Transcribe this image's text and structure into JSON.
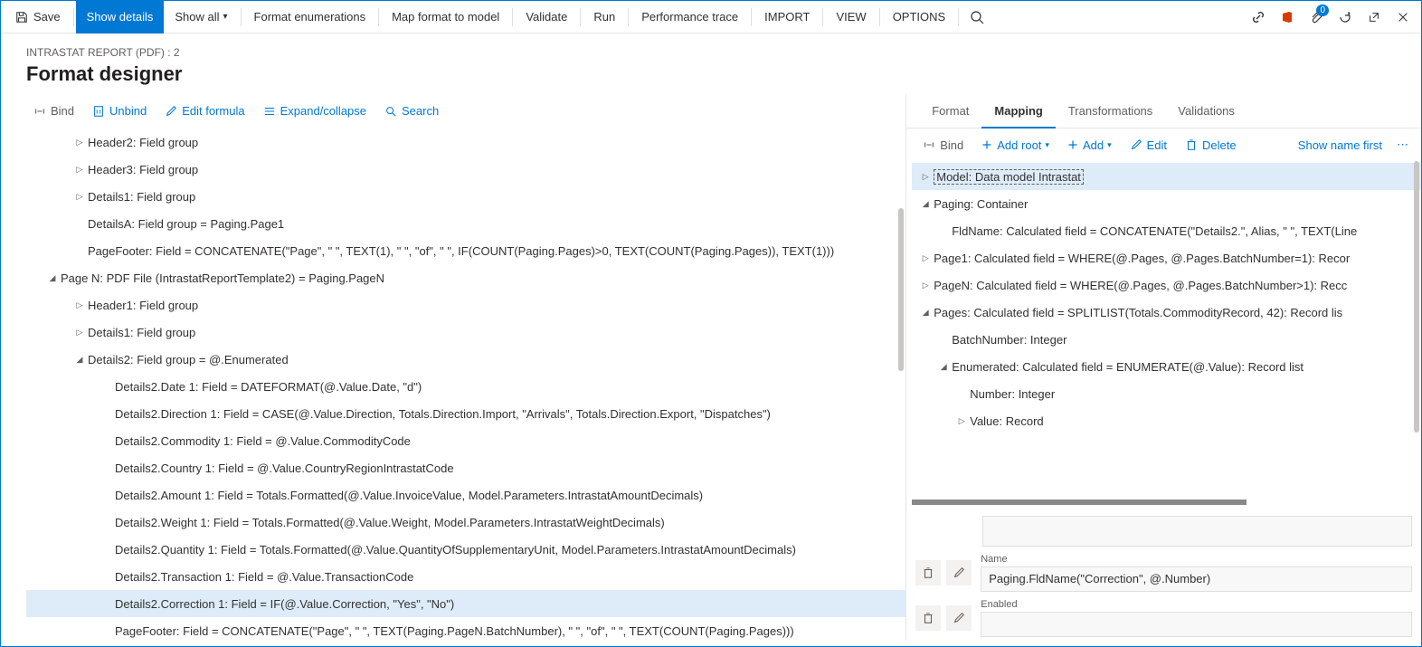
{
  "toolbar": {
    "save": "Save",
    "show_details": "Show details",
    "show_all": "Show all",
    "format_enum": "Format enumerations",
    "map_format": "Map format to model",
    "validate": "Validate",
    "run": "Run",
    "perf_trace": "Performance trace",
    "import": "IMPORT",
    "view": "VIEW",
    "options": "OPTIONS",
    "badge_count": "0"
  },
  "breadcrumb": "INTRASTAT REPORT (PDF) : 2",
  "page_title": "Format designer",
  "left_actions": {
    "bind": "Bind",
    "unbind": "Unbind",
    "edit_formula": "Edit formula",
    "expand": "Expand/collapse",
    "search": "Search"
  },
  "left_tree": [
    {
      "indent": 1,
      "toggle": "▷",
      "label": "Header2: Field group"
    },
    {
      "indent": 1,
      "toggle": "▷",
      "label": "Header3: Field group"
    },
    {
      "indent": 1,
      "toggle": "▷",
      "label": "Details1: Field group"
    },
    {
      "indent": 1,
      "toggle": "",
      "label": "DetailsA: Field group = Paging.Page1"
    },
    {
      "indent": 1,
      "toggle": "",
      "label": "PageFooter: Field = CONCATENATE(\"Page\", \" \", TEXT(1), \" \", \"of\", \" \", IF(COUNT(Paging.Pages)>0, TEXT(COUNT(Paging.Pages)), TEXT(1)))"
    },
    {
      "indent": 0,
      "toggle": "◢",
      "label": "Page N: PDF File (IntrastatReportTemplate2) = Paging.PageN"
    },
    {
      "indent": 1,
      "toggle": "▷",
      "label": "Header1: Field group"
    },
    {
      "indent": 1,
      "toggle": "▷",
      "label": "Details1: Field group"
    },
    {
      "indent": 1,
      "toggle": "◢",
      "label": "Details2: Field group = @.Enumerated"
    },
    {
      "indent": 2,
      "toggle": "",
      "label": "Details2.Date 1: Field = DATEFORMAT(@.Value.Date, \"d\")"
    },
    {
      "indent": 2,
      "toggle": "",
      "label": "Details2.Direction 1: Field = CASE(@.Value.Direction, Totals.Direction.Import, \"Arrivals\", Totals.Direction.Export, \"Dispatches\")"
    },
    {
      "indent": 2,
      "toggle": "",
      "label": "Details2.Commodity 1: Field = @.Value.CommodityCode"
    },
    {
      "indent": 2,
      "toggle": "",
      "label": "Details2.Country 1: Field = @.Value.CountryRegionIntrastatCode"
    },
    {
      "indent": 2,
      "toggle": "",
      "label": "Details2.Amount 1: Field = Totals.Formatted(@.Value.InvoiceValue, Model.Parameters.IntrastatAmountDecimals)"
    },
    {
      "indent": 2,
      "toggle": "",
      "label": "Details2.Weight 1: Field = Totals.Formatted(@.Value.Weight, Model.Parameters.IntrastatWeightDecimals)"
    },
    {
      "indent": 2,
      "toggle": "",
      "label": "Details2.Quantity 1: Field = Totals.Formatted(@.Value.QuantityOfSupplementaryUnit, Model.Parameters.IntrastatAmountDecimals)"
    },
    {
      "indent": 2,
      "toggle": "",
      "label": "Details2.Transaction 1: Field = @.Value.TransactionCode"
    },
    {
      "indent": 2,
      "toggle": "",
      "label": "Details2.Correction 1: Field = IF(@.Value.Correction, \"Yes\", \"No\")",
      "selected": true
    },
    {
      "indent": 2,
      "toggle": "",
      "label": "PageFooter: Field = CONCATENATE(\"Page\", \" \", TEXT(Paging.PageN.BatchNumber), \" \", \"of\", \" \", TEXT(COUNT(Paging.Pages)))"
    }
  ],
  "tabs": {
    "format": "Format",
    "mapping": "Mapping",
    "transformations": "Transformations",
    "validations": "Validations"
  },
  "right_actions": {
    "bind": "Bind",
    "add_root": "Add root",
    "add": "Add",
    "edit": "Edit",
    "delete": "Delete",
    "show_name": "Show name first"
  },
  "right_tree": [
    {
      "indent": 0,
      "toggle": "▷",
      "label": "Model: Data model Intrastat",
      "selected": true
    },
    {
      "indent": 0,
      "toggle": "◢",
      "label": "Paging: Container"
    },
    {
      "indent": 1,
      "toggle": "",
      "label": "FldName: Calculated field = CONCATENATE(\"Details2.\", Alias, \" \", TEXT(Line"
    },
    {
      "indent": 0,
      "toggle": "▷",
      "label": "Page1: Calculated field = WHERE(@.Pages, @.Pages.BatchNumber=1): Recor"
    },
    {
      "indent": 0,
      "toggle": "▷",
      "label": "PageN: Calculated field = WHERE(@.Pages, @.Pages.BatchNumber>1): Recc"
    },
    {
      "indent": 0,
      "toggle": "◢",
      "label": "Pages: Calculated field = SPLITLIST(Totals.CommodityRecord, 42): Record lis"
    },
    {
      "indent": 1,
      "toggle": "",
      "label": "BatchNumber: Integer"
    },
    {
      "indent": 1,
      "toggle": "◢",
      "label": "Enumerated: Calculated field = ENUMERATE(@.Value): Record list"
    },
    {
      "indent": 2,
      "toggle": "",
      "label": "Number: Integer"
    },
    {
      "indent": 2,
      "toggle": "▷",
      "label": "Value: Record"
    }
  ],
  "props": {
    "name_label": "Name",
    "name_value": "Paging.FldName(\"Correction\", @.Number)",
    "enabled_label": "Enabled",
    "enabled_value": ""
  }
}
